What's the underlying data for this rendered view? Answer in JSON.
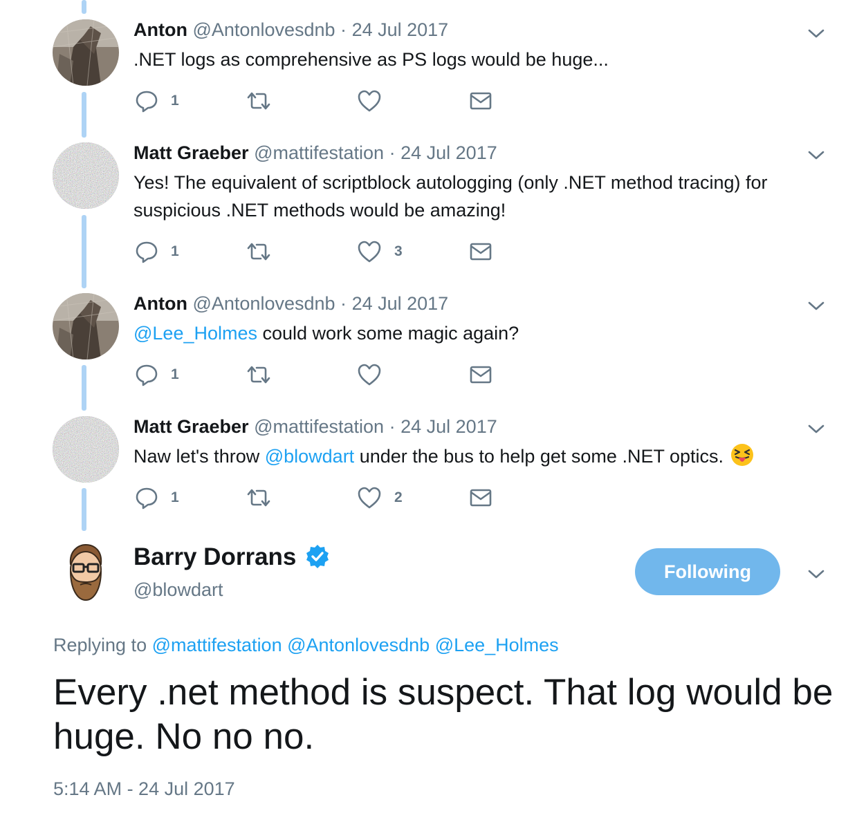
{
  "thread": [
    {
      "name": "Anton",
      "handle": "@Antonlovesdnb",
      "sep": "·",
      "date": "24 Jul 2017",
      "text_parts": [
        ".NET logs as comprehensive as PS logs would be huge..."
      ],
      "reply_count": "1",
      "retweet_count": "",
      "like_count": ""
    },
    {
      "name": "Matt Graeber",
      "handle": "@mattifestation",
      "sep": "·",
      "date": "24 Jul 2017",
      "text_parts": [
        "Yes! The equivalent of scriptblock autologging (only .NET method tracing) for suspicious .NET methods would be amazing!"
      ],
      "reply_count": "1",
      "retweet_count": "",
      "like_count": "3"
    },
    {
      "name": "Anton",
      "handle": "@Antonlovesdnb",
      "sep": "·",
      "date": "24 Jul 2017",
      "mention": "@Lee_Holmes",
      "text_after": " could work some magic again?",
      "reply_count": "1",
      "retweet_count": "",
      "like_count": ""
    },
    {
      "name": "Matt Graeber",
      "handle": "@mattifestation",
      "sep": "·",
      "date": "24 Jul 2017",
      "text_before": "Naw let's throw ",
      "mention": "@blowdart",
      "text_after": " under the bus to help get some .NET optics.",
      "emoji": "squinting-face-with-tongue",
      "reply_count": "1",
      "retweet_count": "",
      "like_count": "2"
    }
  ],
  "main_tweet": {
    "name": "Barry Dorrans",
    "handle": "@blowdart",
    "verified": true,
    "follow_button_label": "Following",
    "replying_label": "Replying to",
    "replying_mentions": [
      "@mattifestation",
      "@Antonlovesdnb",
      "@Lee_Holmes"
    ],
    "text": "Every .net method is suspect. That log would be huge. No no no.",
    "timestamp": "5:14 AM - 24 Jul 2017"
  },
  "colors": {
    "link": "#1da1f2",
    "secondary": "#657786",
    "primary_text": "#14171a",
    "follow_button": "#71b7ec",
    "thread_line": "#aed3f5"
  },
  "icons": [
    "reply-icon",
    "retweet-icon",
    "like-icon",
    "message-icon",
    "chevron-down-icon",
    "verified-badge-icon"
  ]
}
